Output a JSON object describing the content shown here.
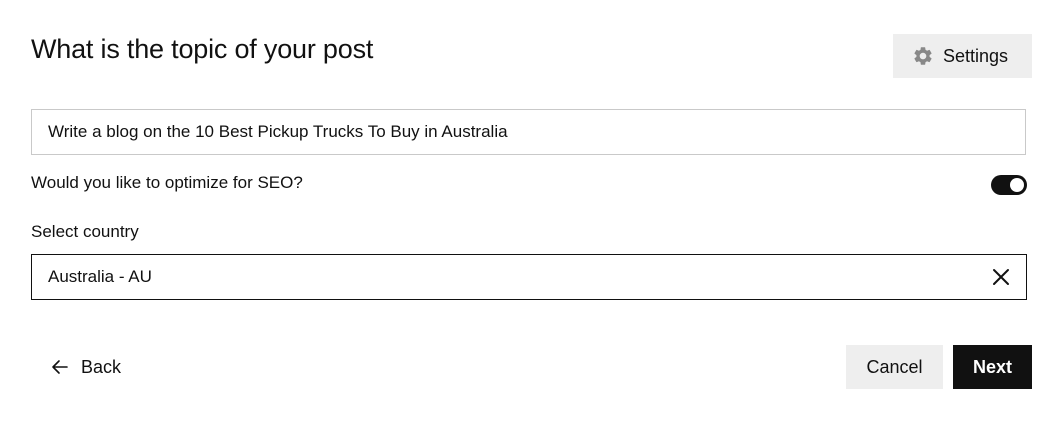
{
  "header": {
    "title": "What is the topic of your post",
    "settings_label": "Settings",
    "settings_icon": "gear-icon"
  },
  "topic": {
    "value": "Write a blog on the 10 Best Pickup Trucks To Buy in Australia"
  },
  "seo": {
    "label": "Would you like to optimize for SEO?",
    "enabled": true
  },
  "country": {
    "label": "Select country",
    "selected": "Australia - AU",
    "clear_icon": "close-icon"
  },
  "footer": {
    "back_label": "Back",
    "back_icon": "arrow-left-icon",
    "cancel_label": "Cancel",
    "next_label": "Next"
  },
  "colors": {
    "primary": "#111111",
    "secondary_bg": "#eeeeee",
    "input_border": "#c9c9c9"
  }
}
